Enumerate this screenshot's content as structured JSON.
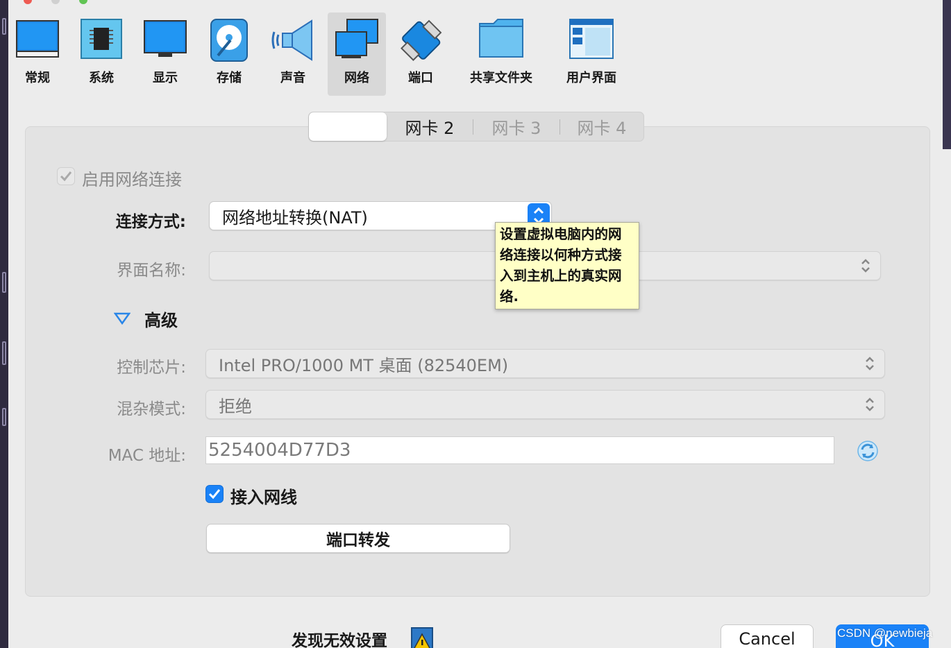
{
  "toolbar": {
    "items": [
      {
        "label": "常规",
        "icon": "monitor-general-icon"
      },
      {
        "label": "系统",
        "icon": "chip-icon"
      },
      {
        "label": "显示",
        "icon": "display-icon"
      },
      {
        "label": "存储",
        "icon": "disk-icon"
      },
      {
        "label": "声音",
        "icon": "speaker-icon"
      },
      {
        "label": "网络",
        "icon": "network-icon",
        "selected": true
      },
      {
        "label": "端口",
        "icon": "serial-port-icon"
      },
      {
        "label": "共享文件夹",
        "icon": "folder-icon"
      },
      {
        "label": "用户界面",
        "icon": "ui-window-icon"
      }
    ]
  },
  "tabs": {
    "tab1": "",
    "tab2": "网卡 2",
    "tab3": "网卡 3",
    "tab4": "网卡 4"
  },
  "form": {
    "enable_label": "启用网络连接",
    "attach_label": "连接方式:",
    "attach_value": "网络地址转换(NAT)",
    "iface_label": "界面名称:",
    "iface_value": "",
    "advanced_label": "高级",
    "adapter_label": "控制芯片:",
    "adapter_value": "Intel PRO/1000 MT 桌面 (82540EM)",
    "promisc_label": "混杂模式:",
    "promisc_value": "拒绝",
    "mac_label": "MAC 地址:",
    "mac_value": "5254004D77D3",
    "cable_label": "接入网线",
    "port_forward_label": "端口转发"
  },
  "tooltip": {
    "line1": "设置虚拟电脑内的网",
    "line2": "络连接以何种方式接",
    "line3": "入到主机上的真实网",
    "line4": "络."
  },
  "footer": {
    "invalid_text": "发现无效设置",
    "cancel_label": "Cancel",
    "ok_label": "OK",
    "watermark": "CSDN @newbieja"
  },
  "colors": {
    "accent": "#1a82f7",
    "tooltip_bg": "#ffffc6"
  }
}
